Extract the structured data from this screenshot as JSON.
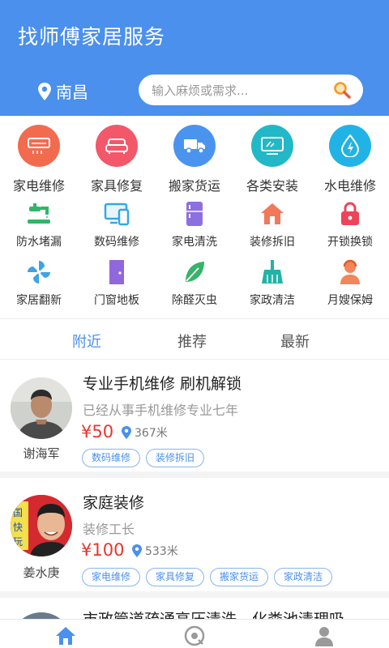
{
  "header": {
    "title": "找师傅家居服务",
    "city": "南昌",
    "search_placeholder": "输入麻烦或需求..."
  },
  "categories_main": [
    {
      "label": "家电维修",
      "icon": "appliance-icon",
      "color": "#f26b4f"
    },
    {
      "label": "家具修复",
      "icon": "sofa-icon",
      "color": "#f2576a"
    },
    {
      "label": "搬家货运",
      "icon": "truck-icon",
      "color": "#4a94ef"
    },
    {
      "label": "各类安装",
      "icon": "monitor-icon",
      "color": "#22b8c8"
    },
    {
      "label": "水电维修",
      "icon": "water-drop-icon",
      "color": "#21b3e6"
    }
  ],
  "categories_row2": [
    {
      "label": "防水堵漏",
      "icon": "faucet-icon"
    },
    {
      "label": "数码维修",
      "icon": "devices-icon"
    },
    {
      "label": "家电清洗",
      "icon": "fridge-icon"
    },
    {
      "label": "装修拆旧",
      "icon": "house-icon"
    },
    {
      "label": "开锁换锁",
      "icon": "lock-icon"
    }
  ],
  "categories_row3": [
    {
      "label": "家居翻新",
      "icon": "pinwheel-icon"
    },
    {
      "label": "门窗地板",
      "icon": "door-icon"
    },
    {
      "label": "除醛灭虫",
      "icon": "leaf-icon"
    },
    {
      "label": "家政清洁",
      "icon": "broom-icon"
    },
    {
      "label": "月嫂保姆",
      "icon": "nanny-icon"
    }
  ],
  "tabs": [
    "附近",
    "推荐",
    "最新"
  ],
  "listings": [
    {
      "name": "谢海军",
      "title": "专业手机维修 刷机解锁",
      "subtitle": "已经从事手机维修专业七年",
      "price": "¥50",
      "distance": "367米",
      "tags": [
        "数码维修",
        "装修拆旧"
      ]
    },
    {
      "name": "姜水庚",
      "title": "家庭装修",
      "subtitle": "装修工长",
      "price": "¥100",
      "distance": "533米",
      "tags": [
        "家电维修",
        "家具修复",
        "搬家货运",
        "家政清洁"
      ]
    },
    {
      "title": "市政管道疏通高压清洗，化粪池清理吸"
    }
  ],
  "colors": {
    "primary": "#4a90ec",
    "price": "#e8352d"
  }
}
